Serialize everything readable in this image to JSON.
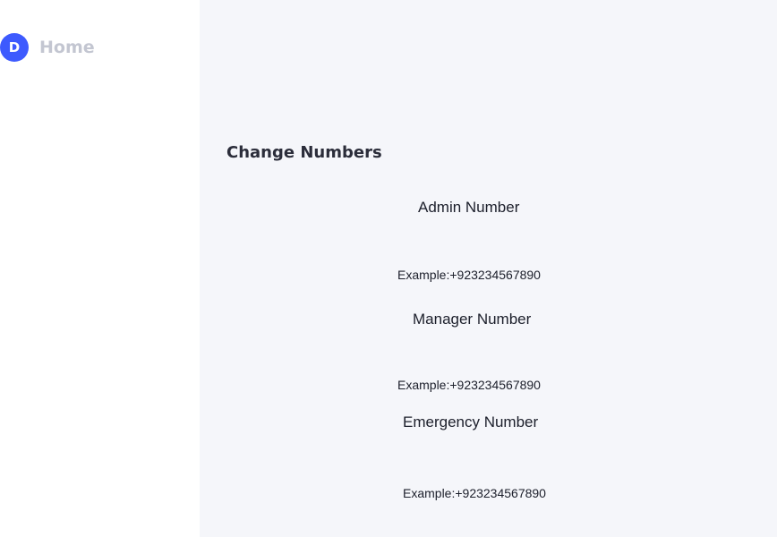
{
  "sidebar": {
    "items": [
      {
        "label": "Home",
        "icon": "home-logo-icon",
        "icon_glyph": "D"
      }
    ]
  },
  "main": {
    "title": "Change Numbers",
    "fields": [
      {
        "label": "Admin Number",
        "placeholder": "Example:+923234567890"
      },
      {
        "label": "Manager Number",
        "placeholder": "Example:+923234567890"
      },
      {
        "label": "Emergency Number",
        "placeholder": "Example:+923234567890"
      }
    ]
  },
  "colors": {
    "accent": "#3d5afe",
    "sidebar_bg": "#ffffff",
    "main_bg": "#f5f6fa",
    "muted_text": "#c3c6d1",
    "text": "#1c1f2b"
  }
}
